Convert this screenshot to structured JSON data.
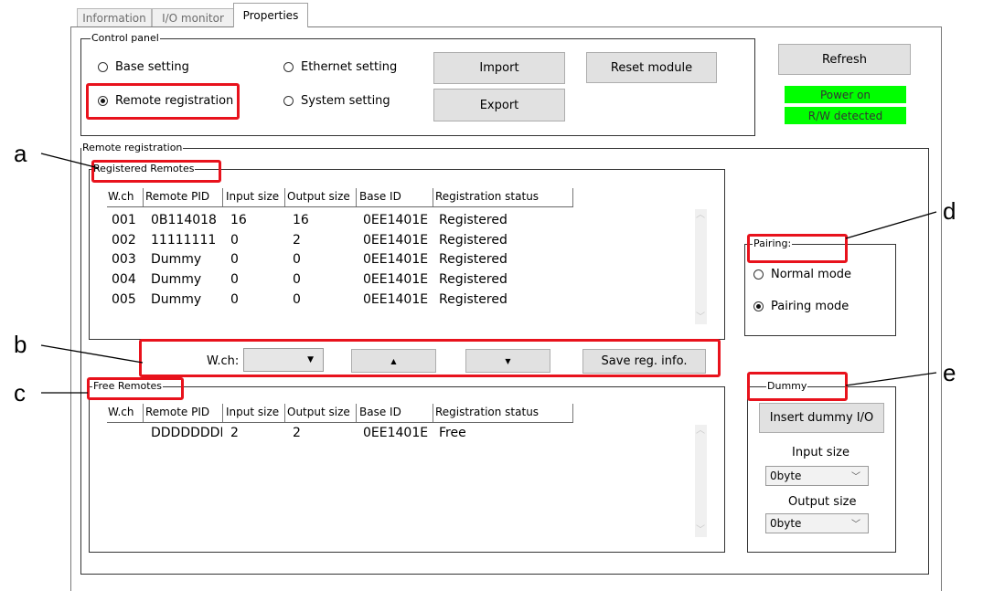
{
  "tabs": [
    {
      "label": "Information"
    },
    {
      "label": "I/O monitor"
    },
    {
      "label": "Properties"
    }
  ],
  "control_panel": {
    "title": "Control panel",
    "radios": [
      {
        "label": "Base setting",
        "checked": false
      },
      {
        "label": "Remote registration",
        "checked": true
      },
      {
        "label": "Ethernet setting",
        "checked": false
      },
      {
        "label": "System setting",
        "checked": false
      }
    ],
    "import_label": "Import",
    "export_label": "Export",
    "reset_label": "Reset module"
  },
  "refresh_label": "Refresh",
  "status": {
    "power": "Power on",
    "rw": "R/W detected",
    "color": "#00ff00"
  },
  "remote_registration": {
    "title": "Remote registration",
    "registered": {
      "title": "Registered Remotes",
      "columns": [
        "W.ch",
        "Remote PID",
        "Input size",
        "Output size",
        "Base ID",
        "Registration status"
      ],
      "rows": [
        [
          "001",
          "0B114018",
          "16",
          "16",
          "0EE1401E",
          "Registered"
        ],
        [
          "002",
          "11111111",
          "0",
          "2",
          "0EE1401E",
          "Registered"
        ],
        [
          "003",
          "Dummy",
          "0",
          "0",
          "0EE1401E",
          "Registered"
        ],
        [
          "004",
          "Dummy",
          "0",
          "0",
          "0EE1401E",
          "Registered"
        ],
        [
          "005",
          "Dummy",
          "0",
          "0",
          "0EE1401E",
          "Registered"
        ]
      ]
    },
    "toolbar": {
      "wch_label": "W.ch:",
      "wch_value": "",
      "up_glyph": "▲",
      "down_glyph": "▼",
      "save_label": "Save reg. info."
    },
    "free": {
      "title": "Free Remotes",
      "columns": [
        "W.ch",
        "Remote PID",
        "Input size",
        "Output size",
        "Base ID",
        "Registration status"
      ],
      "rows": [
        [
          "",
          "DDDDDDDD",
          "2",
          "2",
          "0EE1401E",
          "Free"
        ]
      ]
    },
    "pairing": {
      "title": "Pairing:",
      "options": [
        {
          "label": "Normal mode",
          "checked": false
        },
        {
          "label": "Pairing mode",
          "checked": true
        }
      ]
    },
    "dummy": {
      "title": "Dummy",
      "insert_label": "Insert dummy I/O",
      "input_size_label": "Input size",
      "input_size_value": "0byte",
      "output_size_label": "Output size",
      "output_size_value": "0byte"
    }
  },
  "annotations": {
    "a": "a",
    "b": "b",
    "c": "c",
    "d": "d",
    "e": "e"
  },
  "highlight_color": "#e8121c"
}
